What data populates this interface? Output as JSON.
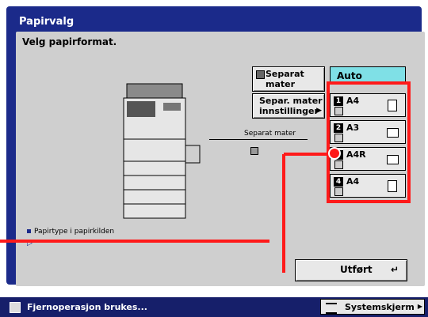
{
  "window": {
    "title": "Papirvalg"
  },
  "prompt": "Velg papirformat.",
  "buttons": {
    "separat_mater": [
      "Separat",
      "mater"
    ],
    "separ_innst": [
      "Separ. mater",
      "innstillinger"
    ],
    "auto": "Auto",
    "utfort": "Utført"
  },
  "trays": [
    {
      "num": "1",
      "size": "A4",
      "orientation": "portrait"
    },
    {
      "num": "2",
      "size": "A3",
      "orientation": "landscape"
    },
    {
      "num": "3",
      "size": "A4R",
      "orientation": "landscape"
    },
    {
      "num": "4",
      "size": "A4",
      "orientation": "portrait"
    }
  ],
  "diagram_label": "Separat mater",
  "footer_note": "Papirtype i papirkilden",
  "status": {
    "message": "Fjernoperasjon brukes...",
    "system_button": "Systemskjerm"
  },
  "colors": {
    "frame": "#1b2a8a",
    "auto_bg": "#7fe0e6",
    "highlight": "#ff1a1a"
  }
}
